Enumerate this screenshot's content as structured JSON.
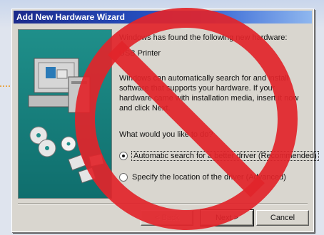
{
  "window": {
    "title": "Add New Hardware Wizard"
  },
  "content": {
    "intro": "Windows has found the following new hardware:",
    "device": "USB Printer",
    "description": "Windows can automatically search for and install software that supports your hardware. If your hardware came with installation media, insert it now and click Next.",
    "question": "What would you like to do?",
    "options": [
      {
        "label": "Automatic search for a better driver (Recommended)",
        "selected": true
      },
      {
        "label": "Specify the location of the driver (Advanced)",
        "selected": false
      }
    ]
  },
  "buttons": {
    "back": "< Back",
    "next": "Next >",
    "cancel": "Cancel"
  },
  "colors": {
    "title_bar_start": "#1b2a8b",
    "title_bar_end": "#8fb7ef",
    "prohibition_red": "#e2242a",
    "panel_teal": "#1f8f8a"
  },
  "icons": {
    "overlay": "prohibition-sign-icon",
    "illustration": "computer-with-cds-icon"
  }
}
